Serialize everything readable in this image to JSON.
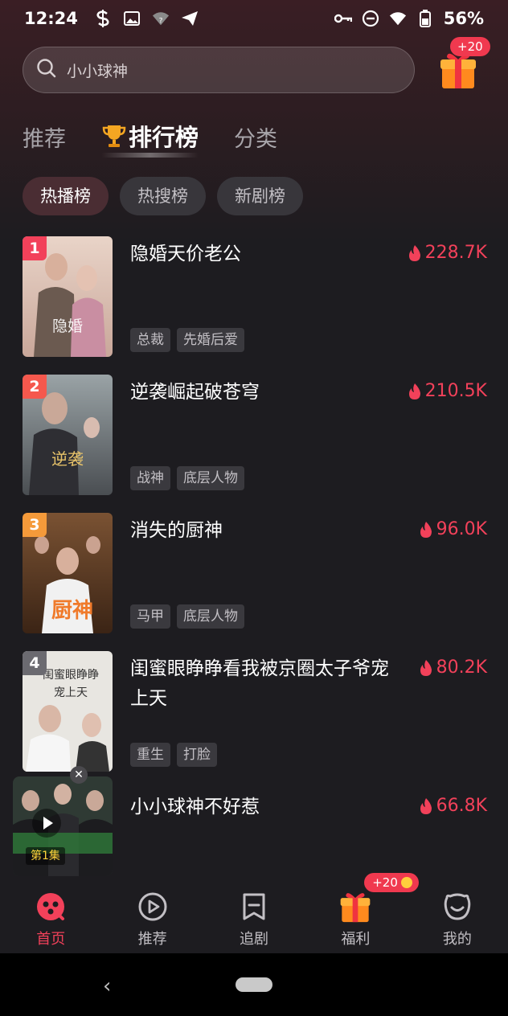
{
  "status_bar": {
    "time": "12:24",
    "battery": "56%",
    "icons_left": [
      "s-icon",
      "image-icon",
      "wifi-question-icon",
      "send-icon"
    ],
    "icons_right": [
      "key-icon",
      "do-not-disturb-icon",
      "wifi-icon",
      "battery-icon"
    ]
  },
  "search": {
    "placeholder": "小小球神"
  },
  "gift": {
    "badge": "+20"
  },
  "top_tabs": [
    {
      "label": "推荐",
      "active": false
    },
    {
      "label": "排行榜",
      "active": true
    },
    {
      "label": "分类",
      "active": false
    }
  ],
  "chips": [
    {
      "label": "热播榜",
      "active": true
    },
    {
      "label": "热搜榜",
      "active": false
    },
    {
      "label": "新剧榜",
      "active": false
    }
  ],
  "ranking": [
    {
      "rank": "1",
      "title": "隐婚天价老公",
      "heat": "228.7K",
      "tags": [
        "总裁",
        "先婚后爱"
      ],
      "rank_color": "#f2415a"
    },
    {
      "rank": "2",
      "title": "逆袭崛起破苍穹",
      "heat": "210.5K",
      "tags": [
        "战神",
        "底层人物"
      ],
      "rank_color": "#f5584d"
    },
    {
      "rank": "3",
      "title": "消失的厨神",
      "heat": "96.0K",
      "tags": [
        "马甲",
        "底层人物"
      ],
      "rank_color": "#f59a3a"
    },
    {
      "rank": "4",
      "title": "闺蜜眼睁睁看我被京圈太子爷宠上天",
      "heat": "80.2K",
      "tags": [
        "重生",
        "打脸"
      ],
      "rank_color": "#6b6a70"
    },
    {
      "rank": "",
      "title": "小小球神不好惹",
      "heat": "66.8K",
      "tags": [],
      "rank_color": ""
    }
  ],
  "mini_player": {
    "episode": "第1集"
  },
  "bottom_nav": [
    {
      "label": "首页",
      "icon": "home-icon",
      "active": true
    },
    {
      "label": "推荐",
      "icon": "play-circle-icon",
      "active": false
    },
    {
      "label": "追剧",
      "icon": "bookmark-icon",
      "active": false
    },
    {
      "label": "福利",
      "icon": "gift-icon",
      "active": false,
      "badge": "+20"
    },
    {
      "label": "我的",
      "icon": "smile-icon",
      "active": false
    }
  ],
  "colors": {
    "accent": "#f2415a",
    "background": "#1d1c20"
  }
}
